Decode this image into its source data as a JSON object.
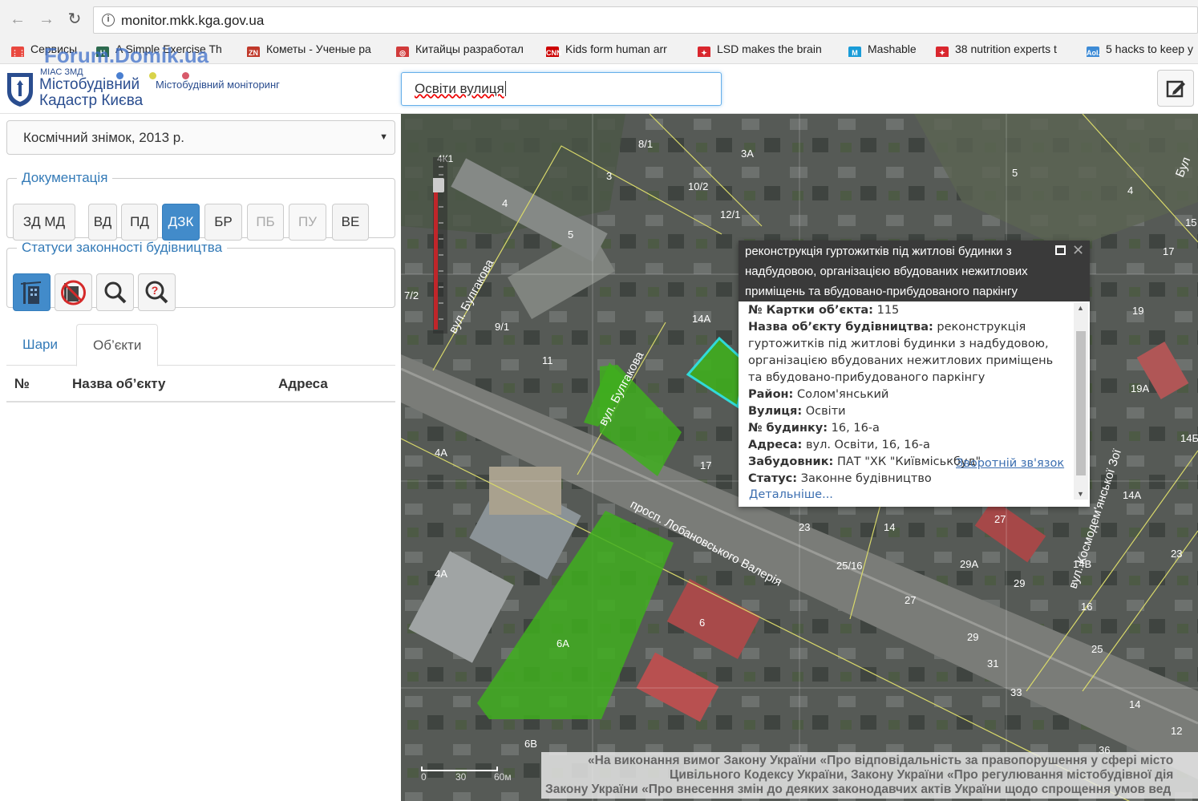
{
  "browser": {
    "url": "monitor.mkk.kga.gov.ua",
    "bookmarks": [
      {
        "label": "Сервисы",
        "icon": "apps-icon",
        "color": "#e9483f"
      },
      {
        "label": "A Simple Exercise Th",
        "icon": "h-icon",
        "color": "#2d6b4f"
      },
      {
        "label": "Кометы - Ученые ра",
        "icon": "zn-icon",
        "color": "#c0392b"
      },
      {
        "label": "Китайцы разработал",
        "icon": "ring-icon",
        "color": "#d13b3b"
      },
      {
        "label": "Kids form human arr",
        "icon": "cnn-icon",
        "color": "#cc0000"
      },
      {
        "label": "LSD makes the brain",
        "icon": "badge-icon",
        "color": "#d9272e"
      },
      {
        "label": "Mashable",
        "icon": "m-icon",
        "color": "#1a9cd8"
      },
      {
        "label": "38 nutrition experts t",
        "icon": "badge-icon",
        "color": "#d9272e"
      },
      {
        "label": "5 hacks to keep y",
        "icon": "aol-icon",
        "color": "#3d8bd6"
      }
    ]
  },
  "watermark": "Forum.Domik.ua",
  "header": {
    "logo_small": "МІАС ЗМД",
    "logo_line1": "Містобудівний",
    "logo_line2": "Кадастр Києва",
    "logo_monitoring": "Містобудівний моніторинг",
    "dots": [
      "#4a7fd0",
      "#d8d34a",
      "#d85a6a"
    ],
    "search_value": "Освіти вулиця"
  },
  "left_panel": {
    "layer_select": "Космічний знімок, 2013 р.",
    "documentation": {
      "legend": "Документація",
      "buttons": [
        {
          "label": "ЗД МД",
          "state": "normal"
        },
        {
          "label": "ВД",
          "state": "normal"
        },
        {
          "label": "ПД",
          "state": "normal"
        },
        {
          "label": "ДЗК",
          "state": "active"
        },
        {
          "label": "БР",
          "state": "normal"
        },
        {
          "label": "ПБ",
          "state": "disabled"
        },
        {
          "label": "ПУ",
          "state": "disabled"
        },
        {
          "label": "ВЕ",
          "state": "normal"
        }
      ]
    },
    "statuses": {
      "legend": "Статуси законності будівництва",
      "buttons": [
        {
          "icon": "crane-building-icon",
          "state": "active"
        },
        {
          "icon": "prohibited-building-icon",
          "state": "normal"
        },
        {
          "icon": "magnifier-icon",
          "state": "normal"
        },
        {
          "icon": "question-magnifier-icon",
          "state": "normal"
        }
      ]
    },
    "tabs": [
      {
        "label": "Шари",
        "active": false
      },
      {
        "label": "Об’єкти",
        "active": true
      }
    ],
    "table_headers": [
      "№",
      "Назва об’єкту",
      "Адреса"
    ]
  },
  "popup": {
    "title": "реконструкція гуртожитків під житлові будинки з надбудовою, організацією вбудованих нежитлових приміщень та вбудовано-прибудованого паркінгу",
    "fields": [
      {
        "label": "№ Картки об’єкта:",
        "value": "115"
      },
      {
        "label": "Назва об’єкту будівництва:",
        "value": "реконструкція гуртожитків під житлові будинки з надбудовою, організацією вбудованих нежитлових приміщень та вбудовано-прибудованого паркінгу"
      },
      {
        "label": "Район:",
        "value": "Солом'янський"
      },
      {
        "label": "Вулиця:",
        "value": "Освіти"
      },
      {
        "label": "№ будинку:",
        "value": "16, 16-а"
      },
      {
        "label": "Адреса:",
        "value": "вул. Освіти, 16, 16-а"
      },
      {
        "label": "Забудовник:",
        "value": "ПАТ \"ХК \"Київміськбуд\""
      },
      {
        "label": "Статус:",
        "value": "Законне будівництво"
      }
    ],
    "feedback_link": "Зворотній зв'язок",
    "details_link": "Детальніше..."
  },
  "map": {
    "street_labels": [
      "вул. Булгакова",
      "вул. Булгакова",
      "просп. Лобановського Валерія",
      "вул. Космодем'янської Зої",
      "Бул"
    ],
    "house_numbers": [
      "8/1",
      "3А",
      "3",
      "10/2",
      "12/1",
      "5",
      "4",
      "4",
      "5",
      "15",
      "17",
      "7/2",
      "9/1",
      "14А",
      "19",
      "11",
      "19А",
      "14Б",
      "17",
      "4А",
      "14А",
      "23",
      "14",
      "27",
      "23",
      "25/16",
      "29А",
      "14В",
      "4А",
      "29",
      "27",
      "6",
      "16",
      "29",
      "25",
      "6А",
      "31",
      "33",
      "14",
      "12",
      "6В",
      "36"
    ],
    "scale_labels": [
      "0",
      "30",
      "60м"
    ],
    "zoom_label": "4К1"
  },
  "legal": {
    "line1": "«На виконання вимог Закону України «Про відповідальність за правопорушення у сфері місто",
    "line2": "Цивільного Кодексу України, Закону України «Про регулювання містобудівної дія",
    "line3": "Закону України «Про внесення змін до деяких законодавчих актів України щодо спрощення умов вед"
  }
}
